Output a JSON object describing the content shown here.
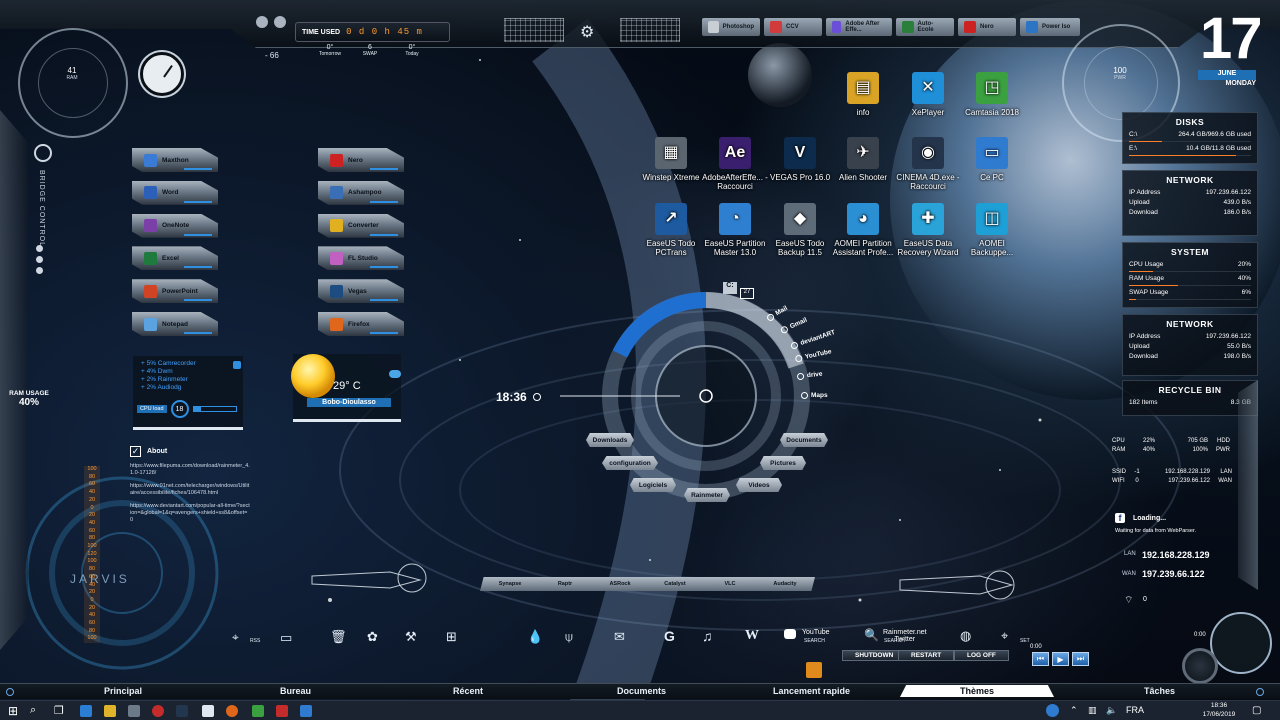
{
  "top": {
    "time_used_label": "TIME USED",
    "time_used_value": "0 d 0 h 45 m",
    "left_num": "66",
    "weather": [
      {
        "temp": "0°",
        "label": "Tomorrow"
      },
      {
        "temp": "6",
        "label": "SWAP"
      },
      {
        "temp": "0°",
        "label": "Today"
      }
    ],
    "dock": [
      {
        "label": "Photoshop",
        "color": "#c9ced5"
      },
      {
        "label": "CCV",
        "color": "#d23b3b"
      },
      {
        "label": "Adobe After Effe...",
        "color": "#6b4fd8"
      },
      {
        "label": "Auto-Ecole",
        "color": "#2a7f3a"
      },
      {
        "label": "Nero",
        "color": "#cc2222"
      },
      {
        "label": "Power Iso",
        "color": "#2c74c4"
      }
    ]
  },
  "gauges": {
    "ram": {
      "value": "41",
      "label": "RAM"
    },
    "pwr": {
      "value": "100",
      "label": "PWR"
    }
  },
  "date": {
    "day": "17",
    "month": "JUNE",
    "weekday": "MONDAY"
  },
  "left": {
    "bridge_control": "BRIDGE CONTROL",
    "ram_usage_label": "RAM USAGE",
    "ram_usage_value": "40%",
    "jarvis": "JARVIS",
    "scale": [
      "100",
      "80",
      "60",
      "40",
      "20",
      "0",
      "20",
      "40",
      "60",
      "80",
      "100",
      "120",
      "100",
      "80",
      "60",
      "40",
      "20",
      "0",
      "20",
      "40",
      "60",
      "80",
      "100"
    ]
  },
  "apps_left": [
    {
      "label": "Maxthon",
      "color": "#3a7bd5"
    },
    {
      "label": "Word",
      "color": "#2b5fb8"
    },
    {
      "label": "OneNote",
      "color": "#7b3fa8"
    },
    {
      "label": "Excel",
      "color": "#1f7a3d"
    },
    {
      "label": "PowerPoint",
      "color": "#d04423"
    },
    {
      "label": "Notepad",
      "color": "#5aa3e0"
    }
  ],
  "apps_mid": [
    {
      "label": "Nero",
      "color": "#cc2222"
    },
    {
      "label": "Ashampoo",
      "color": "#3b6fb5"
    },
    {
      "label": "Converter",
      "color": "#e0b020"
    },
    {
      "label": "FL Studio",
      "color": "#c060c0"
    },
    {
      "label": "Vegas",
      "color": "#1d4d80"
    },
    {
      "label": "Firefox",
      "color": "#e0661c"
    }
  ],
  "processes": {
    "items": [
      "+ 5% Camrecorder",
      "+ 4% Dwm",
      "+ 2% Rainmeter",
      "+ 2% Audiodg"
    ],
    "cpu_load_label": "CPU load",
    "cpu_load_value": "18"
  },
  "weather_widget": {
    "temp": "29° C",
    "city": "Bobo-Dioulasso"
  },
  "about": {
    "title": "About",
    "links": [
      "https://www.filepuma.com/download/rainmeter_4.1.0-17128/",
      "https://www.01net.com/telecharger/windows/Utilitaire/accessibilite/fiches/106478.html",
      "https://www.deviantart.com/popular-all-time/?section=&global=1&q=avengers+shield+ss8&offset=0"
    ]
  },
  "desktop_icons": [
    {
      "label": "info",
      "color": "#d9a425",
      "glyph": "▤"
    },
    {
      "label": "XePlayer",
      "color": "#1f8fd8",
      "glyph": "✕"
    },
    {
      "label": "Camtasia 2018",
      "color": "#3aa040",
      "glyph": "◳"
    },
    {
      "label": "Winstep Xtreme",
      "color": "#5b6570",
      "glyph": "▦"
    },
    {
      "label": "AdobeAfterEffe... - Raccourci",
      "color": "#3a1f6e",
      "glyph": "Ae"
    },
    {
      "label": "VEGAS Pro 16.0",
      "color": "#0d2b4d",
      "glyph": "V"
    },
    {
      "label": "Alien Shooter",
      "color": "#39424c",
      "glyph": "✈"
    },
    {
      "label": "CINEMA 4D.exe - Raccourci",
      "color": "#24344a",
      "glyph": "◉"
    },
    {
      "label": "Ce PC",
      "color": "#2f7bd0",
      "glyph": "▭"
    },
    {
      "label": "EaseUS Todo PCTrans",
      "color": "#1d5aa0",
      "glyph": "↗"
    },
    {
      "label": "EaseUS Partition Master 13.0",
      "color": "#2f7fd0",
      "glyph": "◔"
    },
    {
      "label": "EaseUS Todo Backup 11.5",
      "color": "#5e6b78",
      "glyph": "◆"
    },
    {
      "label": "AOMEI Partition Assistant Profe...",
      "color": "#2b8fd4",
      "glyph": "◕"
    },
    {
      "label": "EaseUS Data Recovery Wizard",
      "color": "#2aa4d8",
      "glyph": "✚"
    },
    {
      "label": "AOMEI Backuppe...",
      "color": "#1e9fd6",
      "glyph": "◫"
    }
  ],
  "launcher": {
    "clock": "18:36",
    "drive_label": "C:",
    "drive_badge": "27",
    "right_links": [
      "Mail",
      "Gmail",
      "deviantART",
      "YouTube",
      "drive",
      "Maps"
    ],
    "folders": [
      "Downloads",
      "configuration",
      "Logiciels",
      "Rainmeter",
      "Videos",
      "Pictures",
      "Documents"
    ]
  },
  "right": {
    "disks_title": "DISKS",
    "disks": [
      {
        "drive": "C:\\",
        "value": "264.4 GB/969.6 GB used",
        "fill": 0.27
      },
      {
        "drive": "E:\\",
        "value": "10.4 GB/11.8 GB used",
        "fill": 0.88
      }
    ],
    "network_title": "NETWORK",
    "network1": [
      {
        "k": "IP Address",
        "v": "197.239.66.122"
      },
      {
        "k": "Upload",
        "v": "439.0 B/s"
      },
      {
        "k": "Download",
        "v": "186.0 B/s"
      }
    ],
    "system_title": "SYSTEM",
    "system": [
      {
        "k": "CPU Usage",
        "v": "20%",
        "fill": 0.2
      },
      {
        "k": "RAM Usage",
        "v": "40%",
        "fill": 0.4
      },
      {
        "k": "SWAP Usage",
        "v": "6%",
        "fill": 0.06
      }
    ],
    "network2": [
      {
        "k": "IP Address",
        "v": "197.239.66.122"
      },
      {
        "k": "Upload",
        "v": "55.0 B/s"
      },
      {
        "k": "Download",
        "v": "198.0 B/s"
      }
    ],
    "recycle_title": "RECYCLE BIN",
    "recycle_items": "182 Items",
    "recycle_size": "8.3 GB",
    "stats": {
      "cpu_label": "CPU",
      "cpu": "22%",
      "hdd_val": "705 GB",
      "hdd": "HDD",
      "ram_label": "RAM",
      "ram": "40%",
      "pwr_val": "100%",
      "pwr": "PWR",
      "ssid_label": "SSID",
      "ssid": "-1",
      "lan_ip": "192.168.228.129",
      "lan": "LAN",
      "wifi_label": "WIFI",
      "wifi": "0",
      "wan_ip": "197.239.66.122",
      "wan": "WAN"
    },
    "fb_loading": "Loading...",
    "fb_wait": "Waiting for data from WebParser.",
    "lan_label": "LAN",
    "lan_ip": "192.168.228.129",
    "wan_label": "WAN",
    "wan_ip": "197.239.66.122",
    "signal": "0"
  },
  "bottom_dock": [
    "Synapse",
    "Raptr",
    "ASRock",
    "Catalyst",
    "VLC",
    "Audacity"
  ],
  "bottom_icons": {
    "rss": "RSS",
    "youtube": "YouTube",
    "youtube_sub": "SEARCH",
    "twitter": "Rainmeter.net Twitter",
    "twitter_sub": "SEARCH",
    "set": "SET"
  },
  "system_buttons": [
    "SHUTDOWN",
    "RESTART",
    "LOG OFF"
  ],
  "player_time": "0:00",
  "clock_time": "0:00",
  "nav": [
    "Principal",
    "Bureau",
    "Récent",
    "Documents",
    "Lancement rapide",
    "Thèmes",
    "Tâches"
  ],
  "taskbar": {
    "lang": "FRA",
    "time": "18:36",
    "date": "17/06/2019"
  }
}
